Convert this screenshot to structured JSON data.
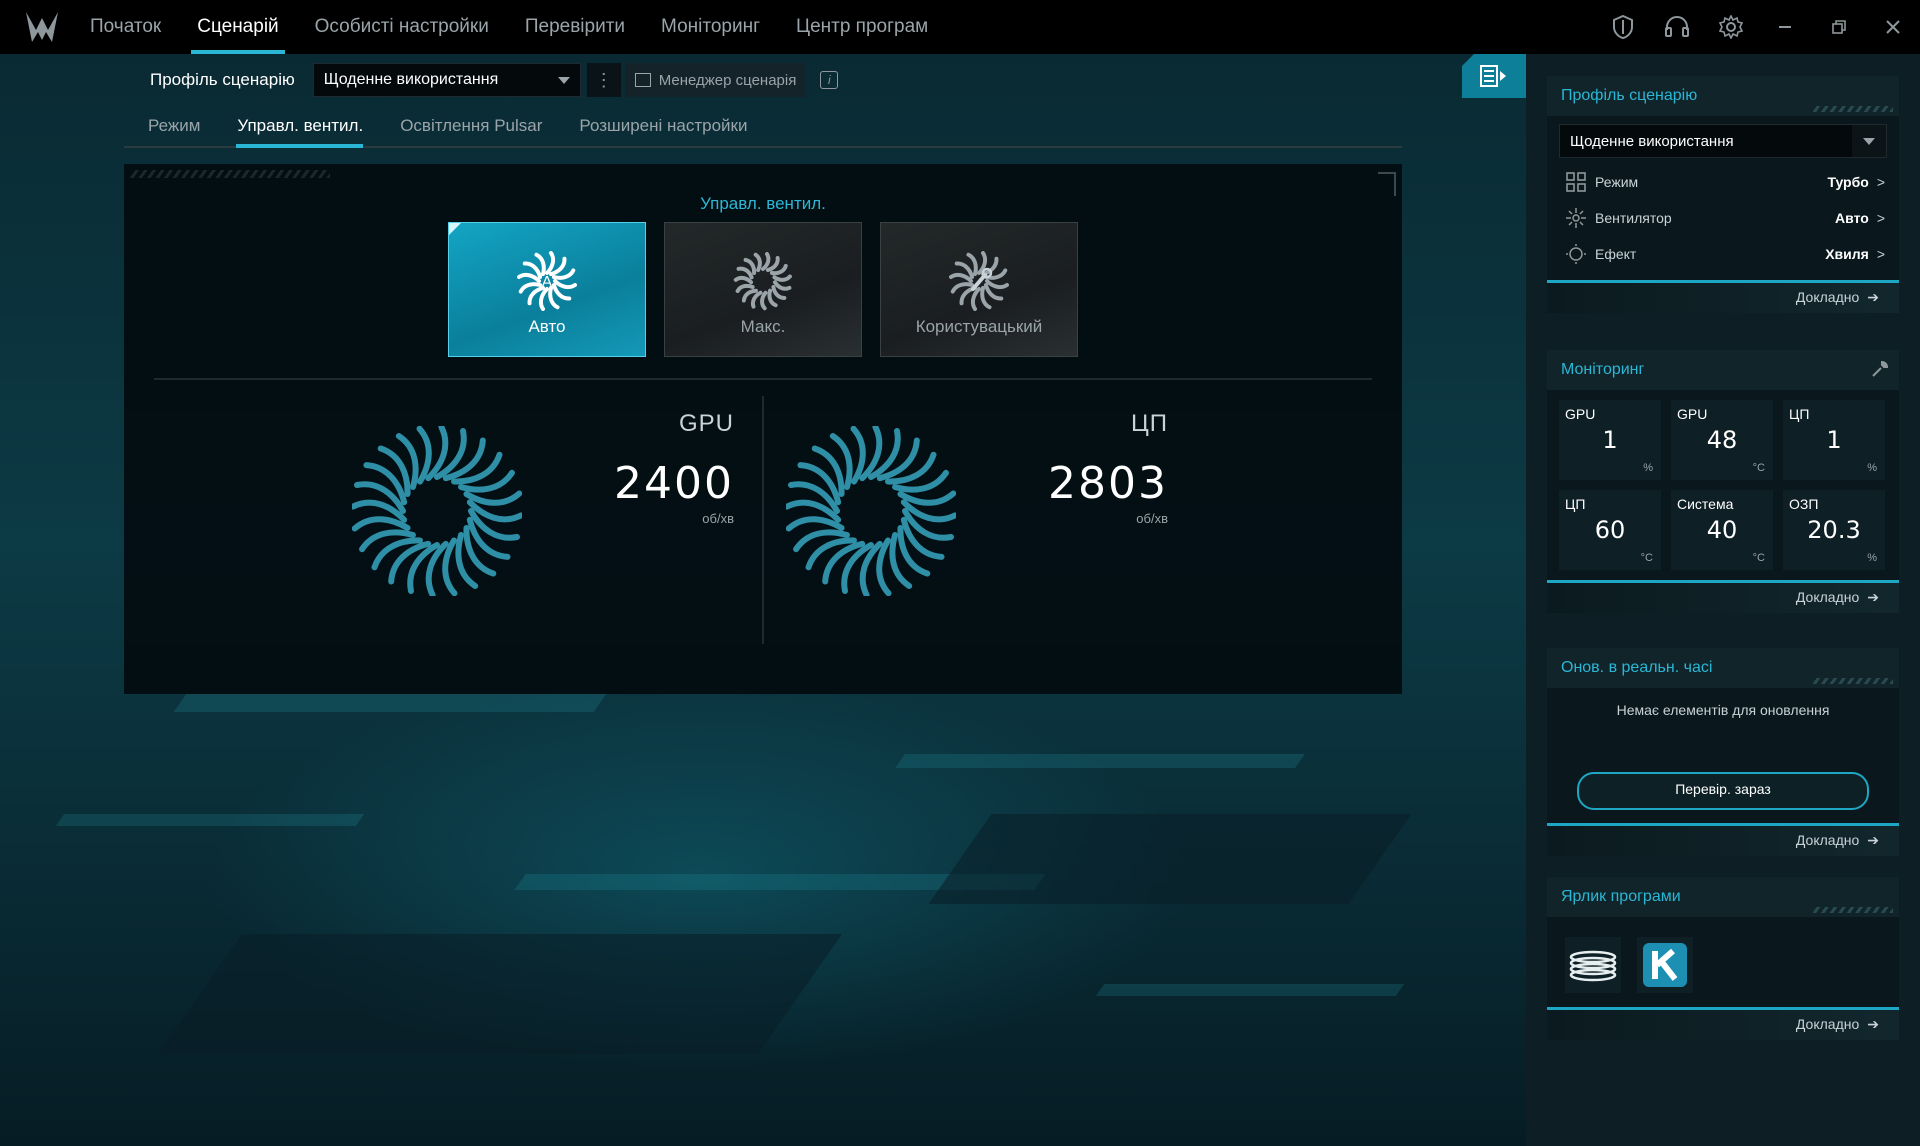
{
  "nav": {
    "items": [
      "Початок",
      "Сценарій",
      "Особисті настройки",
      "Перевірити",
      "Моніторинг",
      "Центр програм"
    ],
    "active_index": 1
  },
  "window_controls": [
    "shield-icon",
    "headset-icon",
    "settings-icon",
    "minimize-icon",
    "restore-icon",
    "close-icon"
  ],
  "profile": {
    "label": "Профіль сценарію",
    "selected": "Щоденне використання",
    "manager_label": "Менеджер сценарія",
    "info_glyph": "i"
  },
  "tabs": {
    "items": [
      "Режим",
      "Управл. вентил.",
      "Освітлення Pulsar",
      "Розширені настройки"
    ],
    "active_index": 1
  },
  "fan_control": {
    "title": "Управл. вентил.",
    "modes": [
      {
        "label": "Авто",
        "icon": "fan-auto-icon",
        "active": true
      },
      {
        "label": "Макс.",
        "icon": "fan-max-icon",
        "active": false
      },
      {
        "label": "Користувацький",
        "icon": "fan-custom-icon",
        "active": false
      }
    ],
    "fans": [
      {
        "name": "GPU",
        "rpm": "2400",
        "unit": "об/хв"
      },
      {
        "name": "ЦП",
        "rpm": "2803",
        "unit": "об/хв"
      }
    ]
  },
  "sidebar": {
    "profile_card": {
      "title": "Профіль сценарію",
      "selected": "Щоденне використання",
      "rows": [
        {
          "name": "Режим",
          "value": "Турбо",
          "icon": "grid-icon"
        },
        {
          "name": "Вентилятор",
          "value": "Авто",
          "icon": "fan-icon"
        },
        {
          "name": "Ефект",
          "value": "Хвиля",
          "icon": "sun-icon"
        }
      ],
      "more": "Докладно"
    },
    "monitoring_card": {
      "title": "Моніторинг",
      "cells": [
        {
          "label": "GPU",
          "value": "1",
          "unit": "%"
        },
        {
          "label": "GPU",
          "value": "48",
          "unit": "°C"
        },
        {
          "label": "ЦП",
          "value": "1",
          "unit": "%"
        },
        {
          "label": "ЦП",
          "value": "60",
          "unit": "°C"
        },
        {
          "label": "Система",
          "value": "40",
          "unit": "°C"
        },
        {
          "label": "ОЗП",
          "value": "20.3",
          "unit": "%"
        }
      ],
      "more": "Докладно"
    },
    "realtime_card": {
      "title": "Онов. в реальн. часі",
      "message": "Немає елементів для оновлення",
      "button": "Перевір. зараз",
      "more": "Докладно"
    },
    "shortcut_card": {
      "title": "Ярлик програми",
      "apps": [
        "app-shortcut-1-icon",
        "app-shortcut-k-icon"
      ],
      "more": "Докладно"
    }
  },
  "colors": {
    "accent": "#2ab7d6",
    "active_button": "#13a5c4",
    "background": "#0a2a33"
  }
}
